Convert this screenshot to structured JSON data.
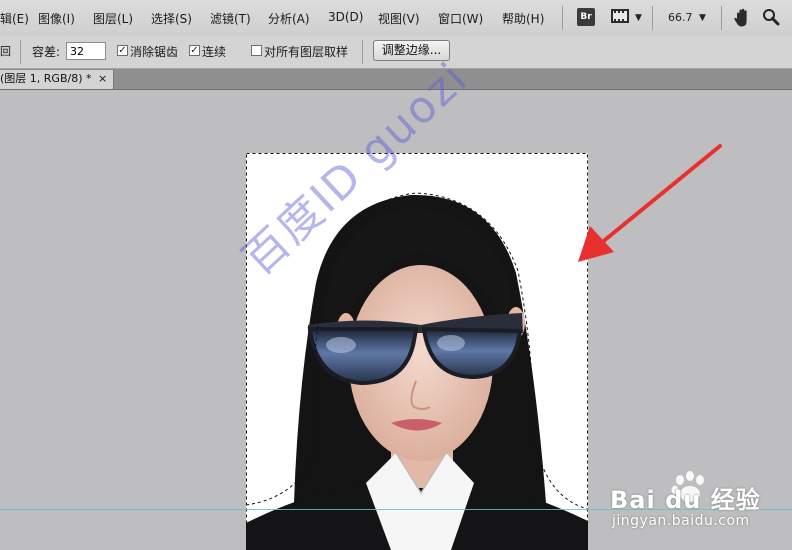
{
  "menubar": {
    "items": [
      "辑(E)",
      "图像(I)",
      "图层(L)",
      "选择(S)",
      "滤镜(T)",
      "分析(A)",
      "3D(D)",
      "视图(V)",
      "窗口(W)",
      "帮助(H)"
    ],
    "br_icon_label": "Br",
    "zoom_value": "66.7"
  },
  "options": {
    "partial_icon": "回",
    "tolerance_label": "容差:",
    "tolerance_value": "32",
    "anti_alias_label": "消除锯齿",
    "anti_alias_checked": true,
    "contiguous_label": "连续",
    "contiguous_checked": true,
    "sample_all_label": "对所有图层取样",
    "sample_all_checked": false,
    "refine_edge_label": "调整边缘..."
  },
  "tab": {
    "label": "(图层 1, RGB/8) *",
    "close": "×"
  },
  "annotation": {
    "arrow_color": "#e8312f"
  },
  "watermark": {
    "diagonal_text": "百度ID guozi",
    "logo_text": "Bai du 经验",
    "url": "jingyan.baidu.com"
  },
  "colors": {
    "canvas_bg": "#bebdbf",
    "menubar_bg": "#d6d6d6",
    "guide": "#5fc6d2"
  }
}
